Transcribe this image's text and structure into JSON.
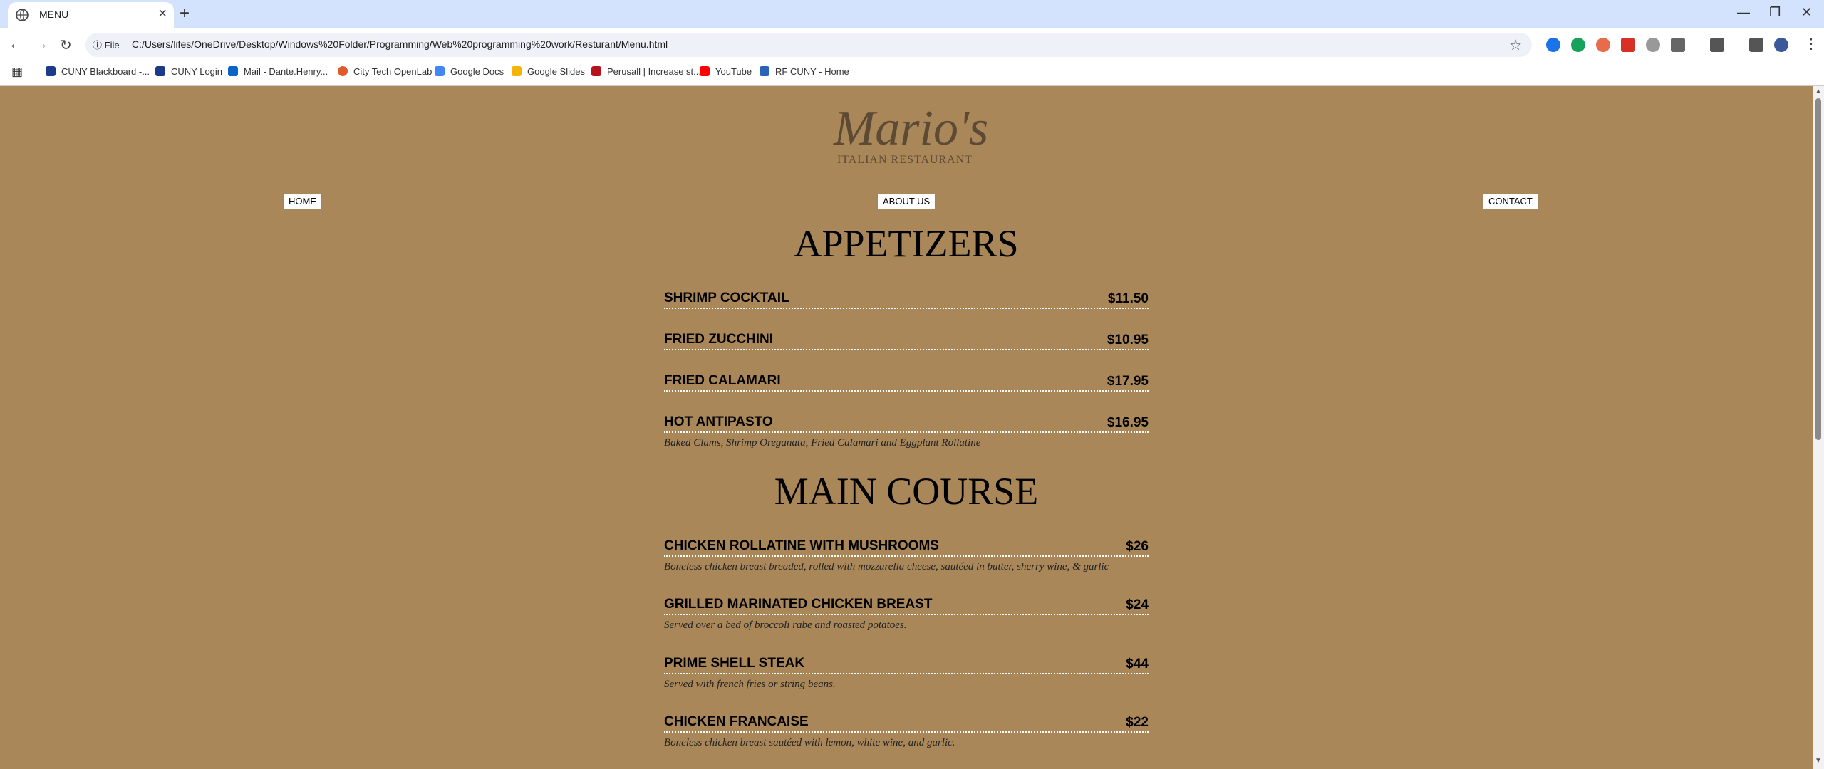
{
  "browser": {
    "tab_title": "MENU",
    "file_label": "File",
    "url": "C:/Users/lifes/OneDrive/Desktop/Windows%20Folder/Programming/Web%20programming%20work/Resturant/Menu.html",
    "bookmarks": [
      {
        "label": "CUNY Blackboard -...",
        "icon": "blackboard-icon",
        "color": "#1c3a8c"
      },
      {
        "label": "CUNY Login",
        "icon": "cuny-icon",
        "color": "#1c3a8c"
      },
      {
        "label": "Mail - Dante.Henry...",
        "icon": "outlook-icon",
        "color": "#0a64c8"
      },
      {
        "label": "City Tech OpenLab",
        "icon": "openlab-icon",
        "color": "#e05a2b"
      },
      {
        "label": "Google Docs",
        "icon": "google-docs-icon",
        "color": "#4285f4"
      },
      {
        "label": "Google Slides",
        "icon": "google-slides-icon",
        "color": "#f4b400"
      },
      {
        "label": "Perusall | Increase st...",
        "icon": "perusall-icon",
        "color": "#b5121b"
      },
      {
        "label": "YouTube",
        "icon": "youtube-icon",
        "color": "#ff0000"
      },
      {
        "label": "RF CUNY - Home",
        "icon": "rfcuny-icon",
        "color": "#2a62b8"
      }
    ]
  },
  "logo": {
    "name": "Mario's",
    "subtitle": "ITALIAN RESTAURANT"
  },
  "nav": {
    "home": "HOME",
    "about": "ABOUT US",
    "contact": "CONTACT"
  },
  "appetizers": {
    "title": "APPETIZERS",
    "items": [
      {
        "name": "SHRIMP COCKTAIL",
        "price": "$11.50",
        "desc": ""
      },
      {
        "name": "FRIED ZUCCHINI",
        "price": "$10.95",
        "desc": ""
      },
      {
        "name": "FRIED CALAMARI",
        "price": "$17.95",
        "desc": ""
      },
      {
        "name": "HOT ANTIPASTO",
        "price": "$16.95",
        "desc": "Baked Clams, Shrimp Oreganata, Fried Calamari and Eggplant Rollatine"
      }
    ]
  },
  "main_course": {
    "title": "MAIN COURSE",
    "items": [
      {
        "name": "CHICKEN ROLLATINE WITH MUSHROOMS",
        "price": "$26",
        "desc": "Boneless chicken breast breaded, rolled with mozzarella cheese, sautéed in butter, sherry wine, & garlic"
      },
      {
        "name": "GRILLED MARINATED CHICKEN BREAST",
        "price": "$24",
        "desc": "Served over a bed of broccoli rabe and roasted potatoes."
      },
      {
        "name": "PRIME SHELL STEAK",
        "price": "$44",
        "desc": "Served with french fries or string beans."
      },
      {
        "name": "CHICKEN FRANCAISE",
        "price": "$22",
        "desc": "Boneless chicken breast sautéed with lemon, white wine, and garlic."
      }
    ]
  },
  "colors": {
    "page_background": "#a98759",
    "tabstrip": "#d3e3fd",
    "logo_text": "#5c4a34"
  }
}
